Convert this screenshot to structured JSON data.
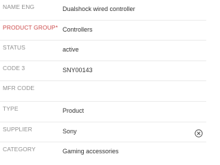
{
  "fields": [
    {
      "label": "NAME ENG",
      "value": "Dualshock wired controller"
    },
    {
      "label": "PRODUCT GROUP*",
      "value": "Controllers"
    },
    {
      "label": "STATUS",
      "value": "active"
    },
    {
      "label": "CODE 3",
      "value": "SNY00143"
    },
    {
      "label": "MFR CODE",
      "value": ""
    },
    {
      "label": "TYPE",
      "value": "Product"
    },
    {
      "label": "SUPPLIER",
      "value": "Sony"
    },
    {
      "label": "CATEGORY",
      "value": "Gaming accessories"
    }
  ],
  "icons": {
    "supplier_clear": "close-circle-icon"
  },
  "colors": {
    "required_label": "#cc4a4a",
    "label": "#8f8f8f",
    "value": "#333333"
  }
}
